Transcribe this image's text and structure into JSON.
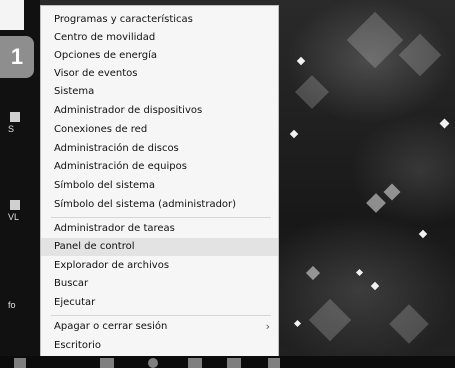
{
  "step_badge": "1",
  "desktop_icons": [
    {
      "label": "S"
    },
    {
      "label": "VL"
    },
    {
      "label": "fo"
    }
  ],
  "menu": {
    "group1": [
      "Programas y características",
      "Centro de movilidad",
      "Opciones de energía",
      "Visor de eventos",
      "Sistema",
      "Administrador de dispositivos",
      "Conexiones de red",
      "Administración de discos",
      "Administración de equipos",
      "Símbolo del sistema",
      "Símbolo del sistema (administrador)"
    ],
    "group2": [
      "Administrador de tareas",
      "Panel de control",
      "Explorador de archivos",
      "Buscar",
      "Ejecutar"
    ],
    "group3": [
      "Apagar o cerrar sesión",
      "Escritorio"
    ],
    "highlighted_item": "Panel de control"
  },
  "colors": {
    "menu_bg": "#f6f6f6",
    "highlight": "#e3e3e3",
    "badge_bg": "#8e8e8e"
  }
}
